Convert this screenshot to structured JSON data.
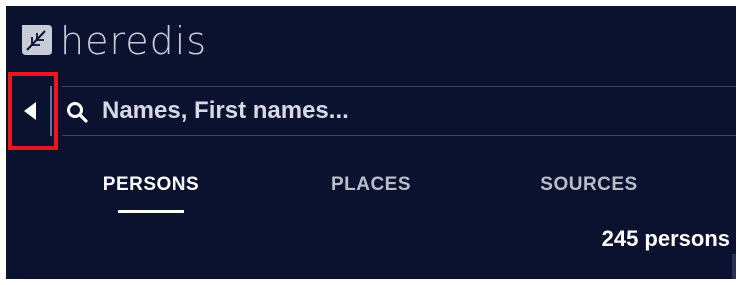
{
  "app": {
    "logo_text": "heredis",
    "logo_icon": "leaf-icon"
  },
  "search": {
    "placeholder": "Names, First names...",
    "value": "",
    "icon": "search-icon",
    "collapse_icon": "caret-left-icon"
  },
  "tabs": [
    {
      "label": "PERSONS",
      "active": true
    },
    {
      "label": "PLACES",
      "active": false
    },
    {
      "label": "SOURCES",
      "active": false
    }
  ],
  "list": {
    "count_label": "245 persons"
  },
  "colors": {
    "background": "#0b1230",
    "highlight_box": "#e8161e",
    "separator": "#3d4564",
    "active_tab": "#ffffff",
    "inactive_tab": "#b9bdca"
  }
}
